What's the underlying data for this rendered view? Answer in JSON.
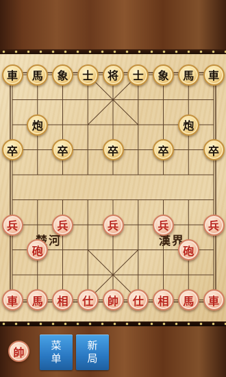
{
  "board": {
    "river_left": "楚河",
    "river_right": "漢界",
    "pieces": [
      {
        "char": "車",
        "side": "black",
        "col": 0,
        "row": 0
      },
      {
        "char": "馬",
        "side": "black",
        "col": 1,
        "row": 0
      },
      {
        "char": "象",
        "side": "black",
        "col": 2,
        "row": 0
      },
      {
        "char": "士",
        "side": "black",
        "col": 3,
        "row": 0
      },
      {
        "char": "将",
        "side": "black",
        "col": 4,
        "row": 0
      },
      {
        "char": "士",
        "side": "black",
        "col": 5,
        "row": 0
      },
      {
        "char": "象",
        "side": "black",
        "col": 6,
        "row": 0
      },
      {
        "char": "馬",
        "side": "black",
        "col": 7,
        "row": 0
      },
      {
        "char": "車",
        "side": "black",
        "col": 8,
        "row": 0
      },
      {
        "char": "炮",
        "side": "black",
        "col": 1,
        "row": 2
      },
      {
        "char": "炮",
        "side": "black",
        "col": 7,
        "row": 2
      },
      {
        "char": "卒",
        "side": "black",
        "col": 0,
        "row": 3
      },
      {
        "char": "卒",
        "side": "black",
        "col": 2,
        "row": 3
      },
      {
        "char": "卒",
        "side": "black",
        "col": 4,
        "row": 3
      },
      {
        "char": "卒",
        "side": "black",
        "col": 6,
        "row": 3
      },
      {
        "char": "卒",
        "side": "black",
        "col": 8,
        "row": 3
      },
      {
        "char": "兵",
        "side": "red",
        "col": 0,
        "row": 6
      },
      {
        "char": "兵",
        "side": "red",
        "col": 2,
        "row": 6
      },
      {
        "char": "兵",
        "side": "red",
        "col": 4,
        "row": 6
      },
      {
        "char": "兵",
        "side": "red",
        "col": 6,
        "row": 6
      },
      {
        "char": "兵",
        "side": "red",
        "col": 8,
        "row": 6
      },
      {
        "char": "砲",
        "side": "red",
        "col": 1,
        "row": 7
      },
      {
        "char": "砲",
        "side": "red",
        "col": 7,
        "row": 7
      },
      {
        "char": "車",
        "side": "red",
        "col": 0,
        "row": 9
      },
      {
        "char": "馬",
        "side": "red",
        "col": 1,
        "row": 9
      },
      {
        "char": "相",
        "side": "red",
        "col": 2,
        "row": 9
      },
      {
        "char": "仕",
        "side": "red",
        "col": 3,
        "row": 9
      },
      {
        "char": "帥",
        "side": "red",
        "col": 4,
        "row": 9
      },
      {
        "char": "仕",
        "side": "red",
        "col": 5,
        "row": 9
      },
      {
        "char": "相",
        "side": "red",
        "col": 6,
        "row": 9
      },
      {
        "char": "馬",
        "side": "red",
        "col": 7,
        "row": 9
      },
      {
        "char": "車",
        "side": "red",
        "col": 8,
        "row": 9
      }
    ]
  },
  "bottom_bar": {
    "turn_piece": "帥",
    "menu_button": [
      "菜",
      "单"
    ],
    "new_game_button": [
      "新",
      "局"
    ]
  }
}
